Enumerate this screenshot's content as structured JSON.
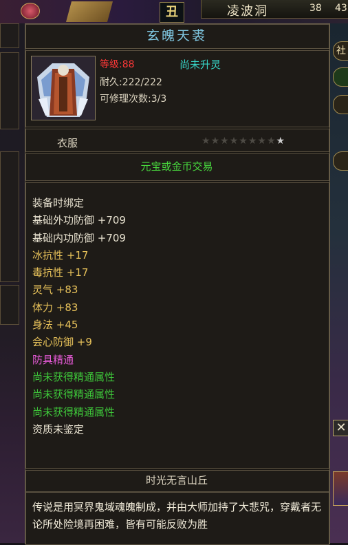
{
  "hud": {
    "scene_glyph": "丑",
    "map_name": "凌波洞",
    "coord_x": "38",
    "coord_y": "43",
    "side_buttons": [
      "社",
      "",
      "",
      ""
    ]
  },
  "tooltip": {
    "title": "玄魄天裘",
    "level_label": "等级",
    "level_value": ":88",
    "spirit_status": "尚未升灵",
    "durability_label": "耐久:",
    "durability_value": "222/222",
    "repair_label": "可修理次数:",
    "repair_value": "3/3",
    "item_type": "衣服",
    "stars_total": 9,
    "stars_filled": 1,
    "trade_info": "元宝或金币交易",
    "stats": [
      {
        "text": "装备时绑定",
        "color": "white"
      },
      {
        "text": "基础外功防御 +709",
        "color": "white"
      },
      {
        "text": "基础内功防御 +709",
        "color": "white"
      },
      {
        "text": "冰抗性 +17",
        "color": "orange"
      },
      {
        "text": "毒抗性 +17",
        "color": "orange"
      },
      {
        "text": "灵气 +83",
        "color": "orange"
      },
      {
        "text": "体力 +83",
        "color": "orange"
      },
      {
        "text": "身法 +45",
        "color": "orange"
      },
      {
        "text": "会心防御 +9",
        "color": "orange"
      },
      {
        "text": "防具精通",
        "color": "pink"
      },
      {
        "text": "尚未获得精通属性",
        "color": "green"
      },
      {
        "text": "尚未获得精通属性",
        "color": "green"
      },
      {
        "text": "尚未获得精通属性",
        "color": "green"
      },
      {
        "text": "资质未鉴定",
        "color": "white"
      }
    ],
    "set_name": "时光无言山丘",
    "lore": "传说是用冥界鬼域魂魄制成，并由大师加持了大悲咒，穿戴者无论所处险境再困难，皆有可能反败为胜"
  },
  "colors": {
    "title": "#7fc6e0",
    "level": "#ff3838",
    "spirit": "#37d6c8",
    "trade": "#48d83e",
    "stat_white": "#e8e2d0",
    "stat_orange": "#e8c25a",
    "stat_pink": "#e85ad8",
    "stat_green": "#3ec83a"
  }
}
